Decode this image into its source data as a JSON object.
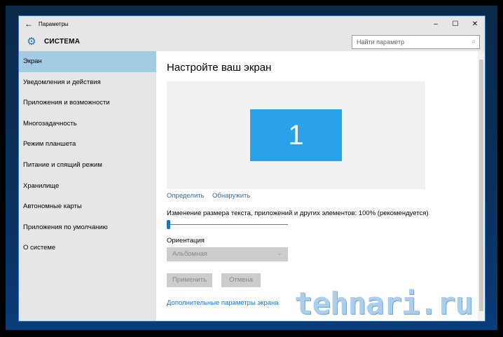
{
  "window": {
    "title": "Параметры",
    "back_icon": "arrow-left-icon",
    "minimize": "–",
    "maximize": "☐",
    "close": "✕"
  },
  "header": {
    "section": "СИСТЕМА",
    "search_placeholder": "Найти параметр"
  },
  "sidebar": {
    "items": [
      {
        "label": "Экран",
        "selected": true
      },
      {
        "label": "Уведомления и действия"
      },
      {
        "label": "Приложения и возможности"
      },
      {
        "label": "Многозадачность"
      },
      {
        "label": "Режим планшета"
      },
      {
        "label": "Питание и спящий режим"
      },
      {
        "label": "Хранилище"
      },
      {
        "label": "Автономные карты"
      },
      {
        "label": "Приложения по умолчанию"
      },
      {
        "label": "О системе"
      }
    ]
  },
  "main": {
    "title": "Настройте ваш экран",
    "monitor_number": "1",
    "identify": "Определить",
    "detect": "Обнаружить",
    "scale_label": "Изменение размера текста, приложений и других элементов: 100% (рекомендуется)",
    "scale_slider_fraction": 0,
    "orientation_label": "Ориентация",
    "orientation_value": "Альбомная",
    "apply": "Применить",
    "cancel": "Отмена",
    "advanced_link": "Дополнительные параметры экрана"
  },
  "watermark": "tehnari.ru",
  "colors": {
    "accent": "#1e72c0",
    "selected": "#a4cbe4",
    "monitor": "#2aa2e9"
  }
}
